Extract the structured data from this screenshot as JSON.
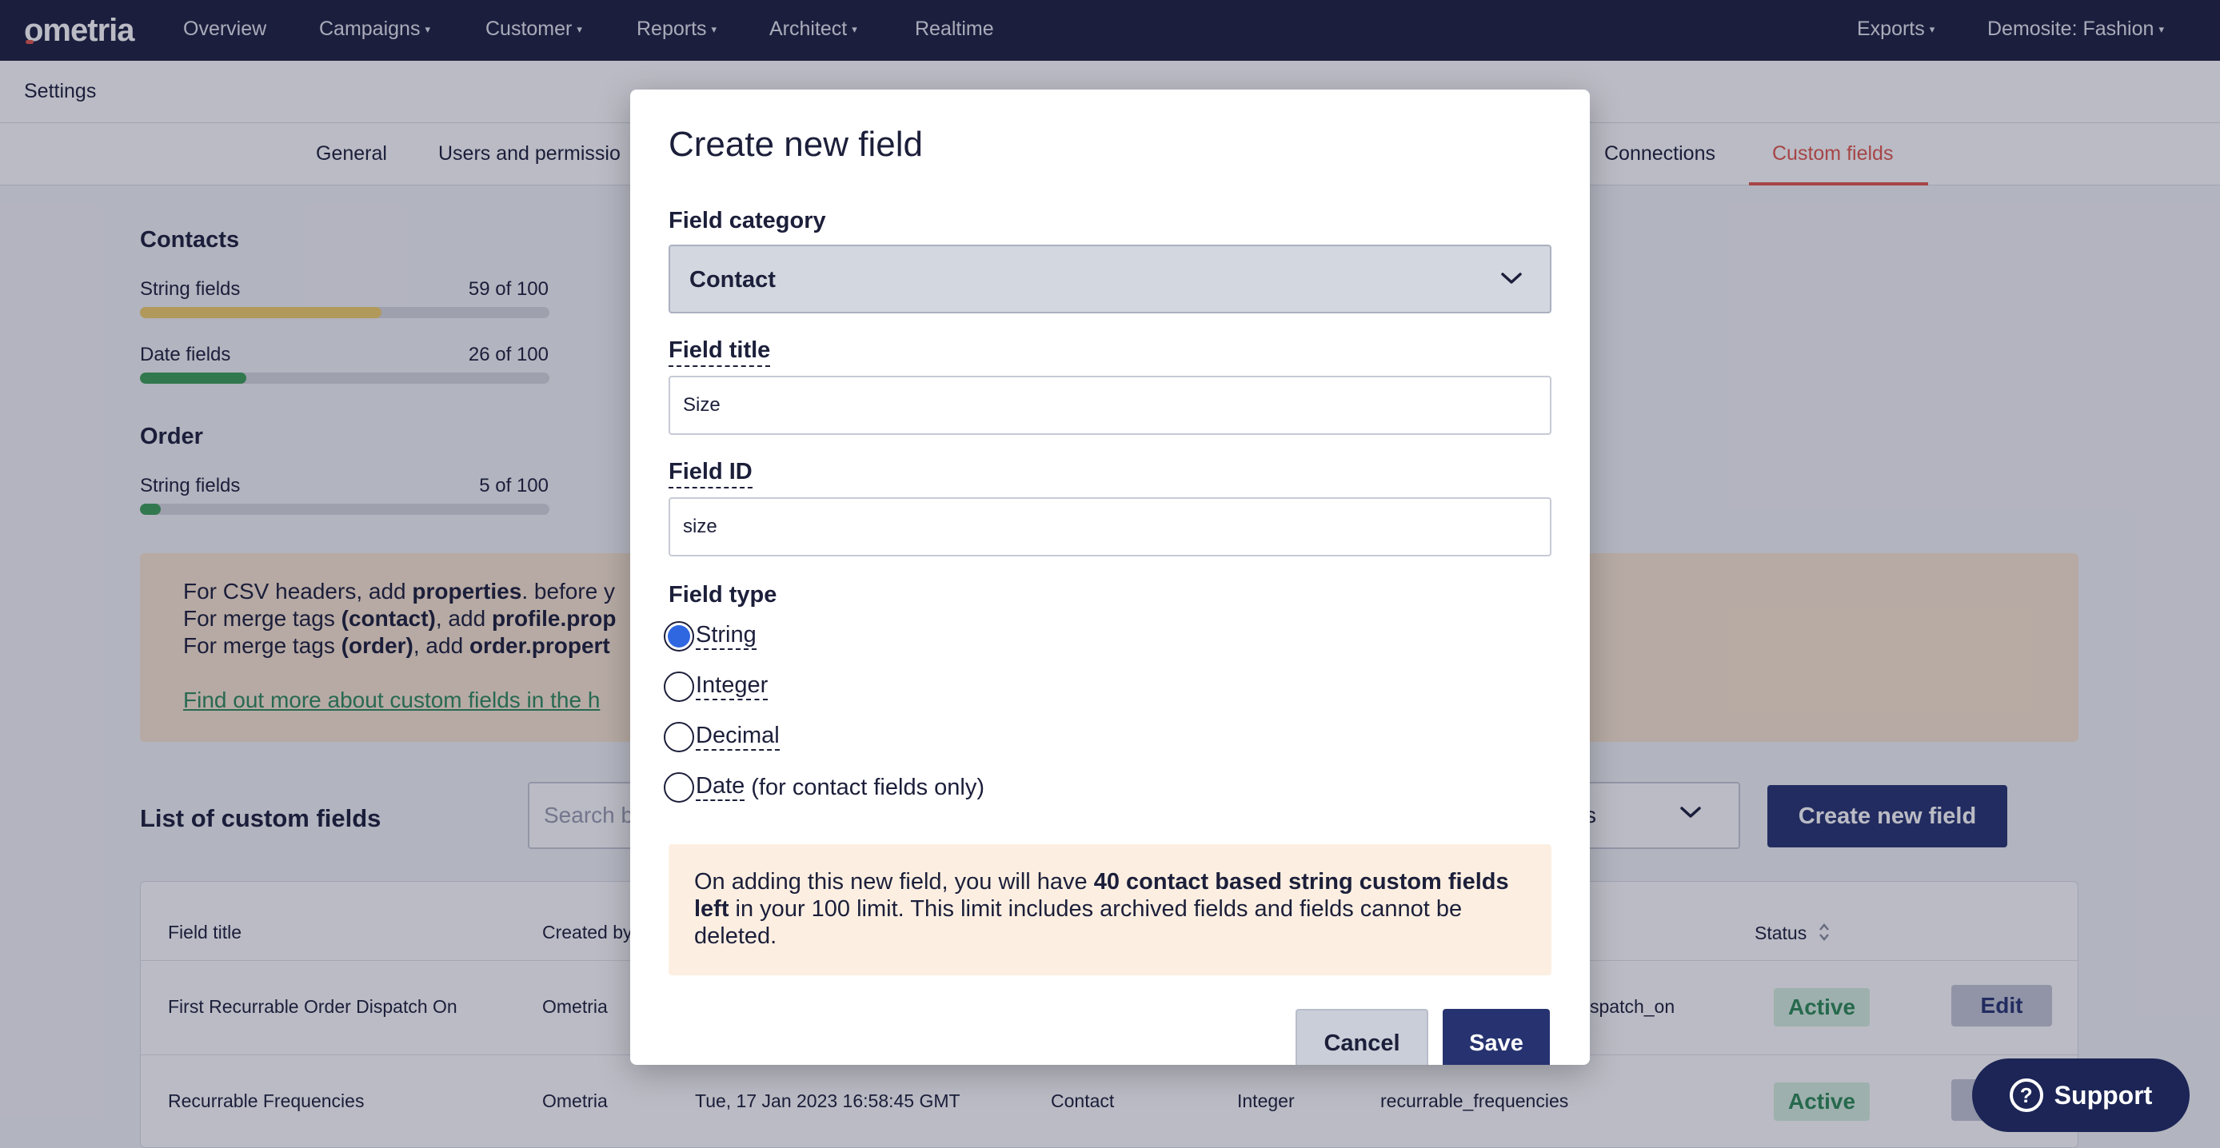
{
  "nav": {
    "logo": "ometria",
    "items": [
      "Overview",
      "Campaigns",
      "Customer",
      "Reports",
      "Architect",
      "Realtime"
    ],
    "right": [
      "Exports",
      "Demosite: Fashion"
    ]
  },
  "settings": {
    "title": "Settings",
    "tabs": [
      "General",
      "Users and permissio",
      "Connections",
      "Custom fields"
    ],
    "active_tab": "Custom fields"
  },
  "usage": {
    "contacts_title": "Contacts",
    "order_title": "Order",
    "contacts": [
      {
        "label": "String fields",
        "count": "59 of 100",
        "fraction": 0.59,
        "color": "#f2cf6a"
      },
      {
        "label": "Date fields",
        "count": "26 of 100",
        "fraction": 0.26,
        "color": "#3da056"
      }
    ],
    "order": [
      {
        "label": "String fields",
        "count": "5 of 100",
        "fraction": 0.05,
        "color": "#3da056"
      }
    ]
  },
  "info_box": {
    "line1_pre": "For CSV headers, add ",
    "line1_bold": "properties",
    "line1_post": ". before y",
    "line2_pre": "For merge tags ",
    "line2_bold1": "(contact)",
    "line2_mid": ", add ",
    "line2_bold2": "profile.prop",
    "line3_pre": "For merge tags ",
    "line3_bold1": "(order)",
    "line3_mid": ", add ",
    "line3_bold2": "order.propert",
    "link": "Find out more about custom fields in the h"
  },
  "list": {
    "title": "List of custom fields",
    "search_placeholder": "Search b",
    "filter_value": "s",
    "create_button": "Create new field",
    "headers": {
      "field_title": "Field title",
      "created_by": "Created by",
      "status": "Status"
    },
    "rows": [
      {
        "title": "First Recurrable Order Dispatch On",
        "created_by": "Ometria",
        "date": "",
        "category": "",
        "type": "",
        "id": "spatch_on",
        "status": "Active",
        "action": "Edit"
      },
      {
        "title": "Recurrable Frequencies",
        "created_by": "Ometria",
        "date": "Tue, 17 Jan 2023 16:58:45 GMT",
        "category": "Contact",
        "type": "Integer",
        "id": "recurrable_frequencies",
        "status": "Active",
        "action": "Edit"
      }
    ]
  },
  "modal": {
    "title": "Create new field",
    "category_label": "Field category",
    "category_value": "Contact",
    "title_label": "Field title",
    "title_value": "Size",
    "id_label": "Field ID",
    "id_value": "size",
    "type_label": "Field type",
    "types": [
      {
        "label": "String",
        "suffix": "",
        "checked": true
      },
      {
        "label": "Integer",
        "suffix": "",
        "checked": false
      },
      {
        "label": "Decimal",
        "suffix": "",
        "checked": false
      },
      {
        "label": "Date",
        "suffix": "(for contact fields only)",
        "checked": false
      }
    ],
    "notice_pre": "On adding this new field, you will have ",
    "notice_bold": "40 contact based string custom fields left",
    "notice_post": " in your 100 limit. This limit includes archived fields and fields cannot be deleted.",
    "cancel_label": "Cancel",
    "save_label": "Save"
  },
  "support": {
    "label": "Support",
    "icon": "question-icon"
  },
  "colors": {
    "nav_bg": "#1c1f3e",
    "accent": "#e2574c",
    "primary": "#263370",
    "active_green": "#2c8a55"
  }
}
